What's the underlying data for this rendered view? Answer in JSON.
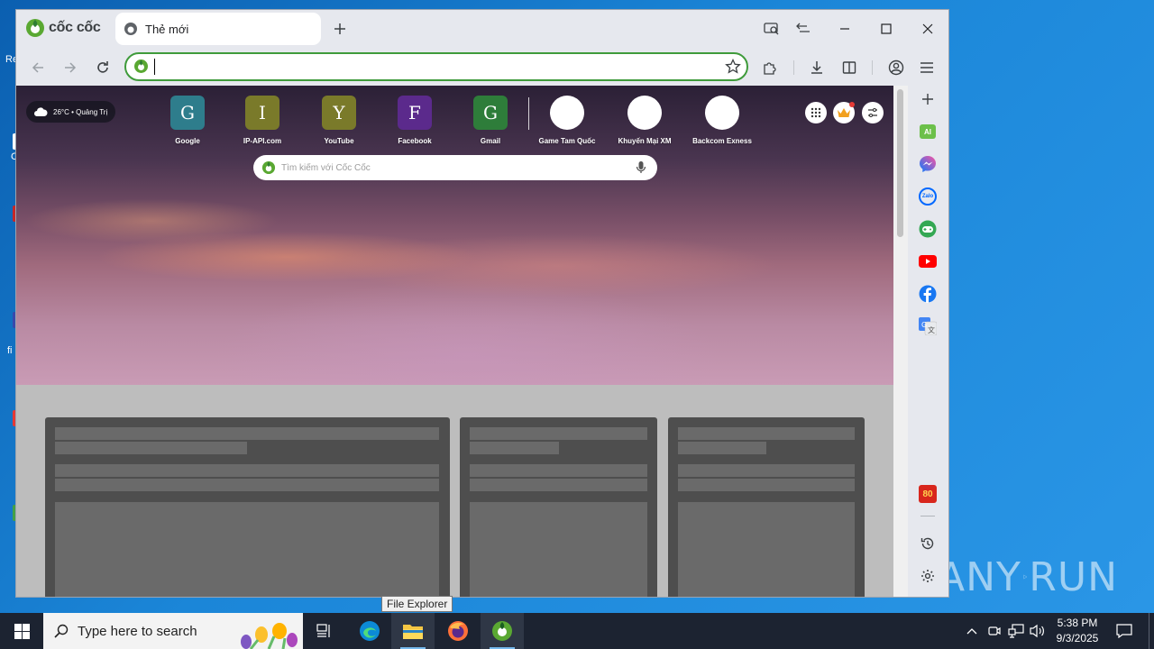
{
  "browser": {
    "brand": "cốc cốc",
    "tab": {
      "title": "Thẻ mới"
    },
    "address_bar": {
      "value": "",
      "placeholder": ""
    }
  },
  "newtab": {
    "weather": {
      "text": "26°C • Quảng Trị"
    },
    "shortcuts": [
      {
        "label": "Google",
        "letter": "G",
        "color": "#2e7d8c"
      },
      {
        "label": "IP-API.com",
        "letter": "I",
        "color": "#7a7a2a"
      },
      {
        "label": "YouTube",
        "letter": "Y",
        "color": "#7a7a2a"
      },
      {
        "label": "Facebook",
        "letter": "F",
        "color": "#5b2a8c"
      },
      {
        "label": "Gmail",
        "letter": "G",
        "color": "#2e7d3a"
      },
      {
        "label": "Game Tam Quốc",
        "letter": "",
        "color": "#ffffff"
      },
      {
        "label": "Khuyến Mại XM",
        "letter": "",
        "color": "#ffffff"
      },
      {
        "label": "Backcom Exness",
        "letter": "",
        "color": "#ffffff"
      }
    ],
    "search": {
      "placeholder": "Tìm kiếm với Cốc Cốc"
    }
  },
  "sidepanel": {
    "icons": [
      "add-icon",
      "ai-icon",
      "messenger-icon",
      "zalo-icon",
      "game-icon",
      "youtube-icon",
      "facebook-icon",
      "translate-icon",
      "80-anniversary-icon",
      "history-icon",
      "settings-icon"
    ],
    "ai_label": "AI",
    "zalo_label": "Zalo",
    "badge_label": "80"
  },
  "tooltip": {
    "text": "File Explorer"
  },
  "taskbar": {
    "search_placeholder": "Type here to search",
    "time": "5:38 PM",
    "date": "9/3/2025"
  },
  "watermark": {
    "text_left": "ANY",
    "text_right": "RUN"
  },
  "desktop_fragments": [
    "Re",
    "C",
    "fi"
  ],
  "colors": {
    "omnibox_border": "#3f9b3b",
    "taskbar": "#1c2331",
    "desktop": "#1b86d8"
  }
}
